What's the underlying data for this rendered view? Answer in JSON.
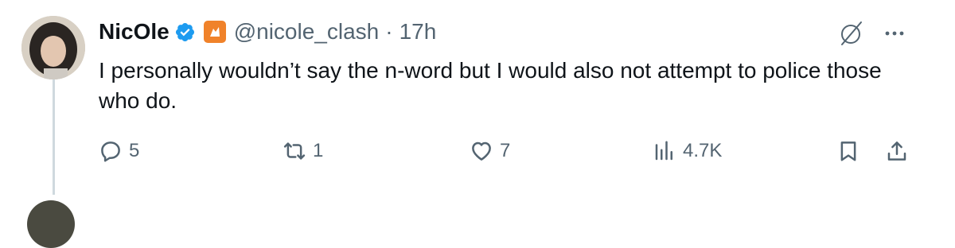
{
  "tweet": {
    "author": {
      "display_name": "NicOle",
      "handle": "@nicole_clash",
      "verified": true,
      "time": "17h"
    },
    "separator": "·",
    "text": "I personally wouldn’t say the n-word but I would also not attempt to police those who do.",
    "actions": {
      "replies": "5",
      "reposts": "1",
      "likes": "7",
      "views": "4.7K"
    }
  },
  "colors": {
    "accent": "#1d9bf0",
    "secondary_text": "#536471",
    "affiliate_badge": "#f0822a",
    "thread_line": "#cfd9de"
  },
  "icons": {
    "verified": "verified-badge-icon",
    "affiliate": "affiliate-badge-icon",
    "grok": "grok-icon",
    "more": "more-icon",
    "reply": "reply-icon",
    "repost": "repost-icon",
    "like": "heart-icon",
    "views": "views-icon",
    "bookmark": "bookmark-icon",
    "share": "share-icon"
  }
}
